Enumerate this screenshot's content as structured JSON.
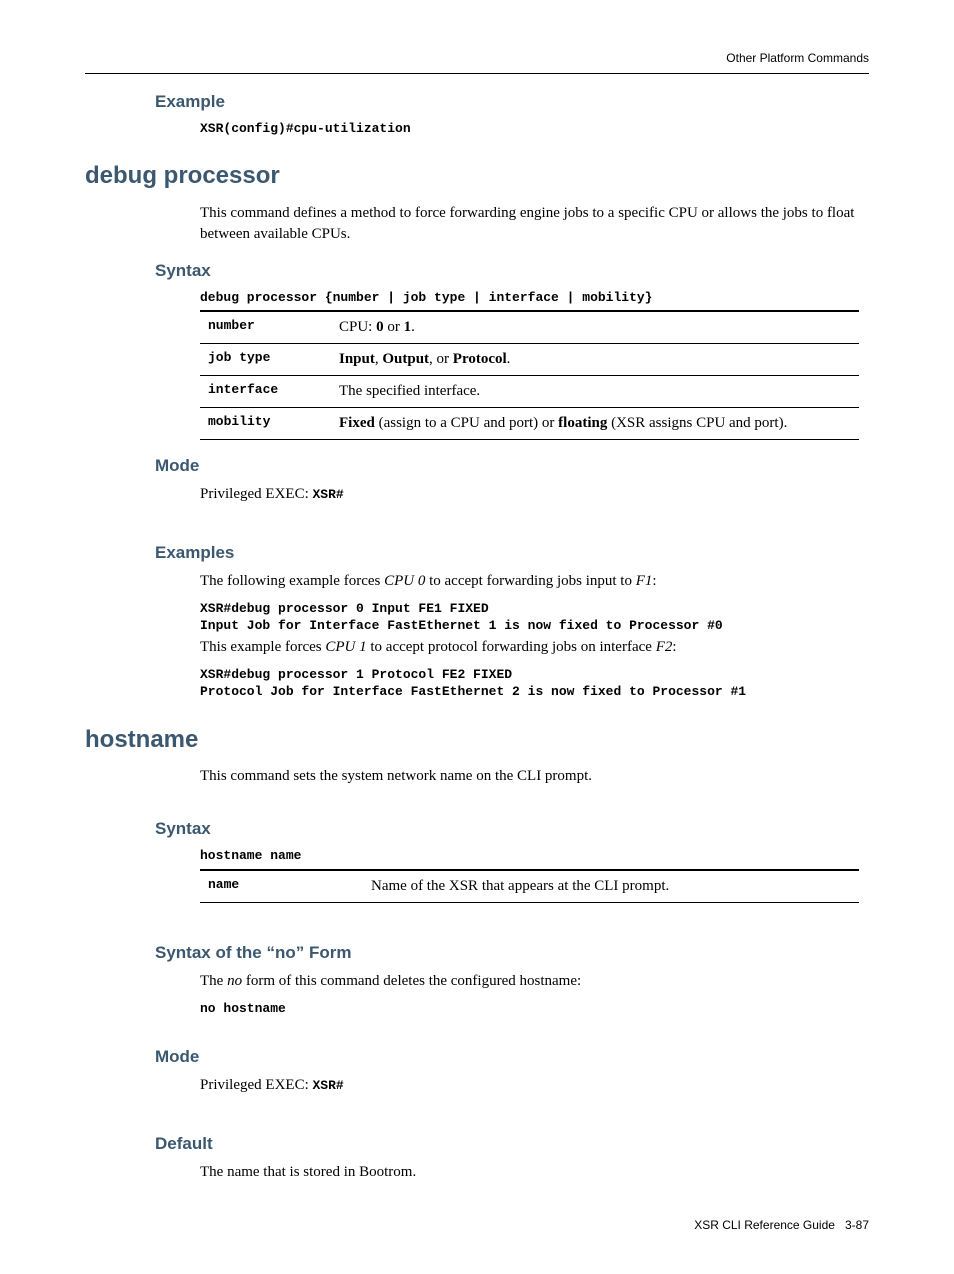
{
  "header": "Other Platform Commands",
  "s1": {
    "title": "Example",
    "code": "XSR(config)#cpu-utilization"
  },
  "s2": {
    "title": "debug processor",
    "intro": "This command defines a method to force forwarding engine jobs to a specific CPU or allows the jobs to float between available CPUs.",
    "syntax_title": "Syntax",
    "syntax_line": "debug processor {number | job type | interface | mobility}",
    "rows": [
      {
        "k": "number",
        "pre": "CPU: ",
        "b1": "0",
        "mid": " or ",
        "b2": "1",
        "post": "."
      },
      {
        "k": "job type",
        "b1": "Input",
        "sep1": ", ",
        "b2": "Output",
        "sep2": ", or ",
        "b3": "Protocol",
        "post": "."
      },
      {
        "k": "interface",
        "text": "The specified interface."
      },
      {
        "k": "mobility",
        "b1": "Fixed",
        "mid1": " (assign to a CPU and port) or ",
        "b2": "floating",
        "mid2": " (XSR assigns CPU and port)."
      }
    ],
    "mode_title": "Mode",
    "mode_pre": "Privileged EXEC: ",
    "mode_code": "XSR#",
    "examples_title": "Examples",
    "ex1_pre": "The following example forces ",
    "ex1_i1": "CPU 0",
    "ex1_mid": " to accept forwarding jobs input to ",
    "ex1_i2": "F1",
    "ex1_post": ":",
    "ex1_code": "XSR#debug processor 0 Input FE1 FIXED\nInput Job for Interface FastEthernet 1 is now fixed to Processor #0",
    "ex2_pre": "This example forces ",
    "ex2_i1": "CPU 1",
    "ex2_mid": " to accept protocol forwarding jobs on interface ",
    "ex2_i2": "F2",
    "ex2_post": ":",
    "ex2_code": "XSR#debug processor 1 Protocol FE2 FIXED\nProtocol Job for Interface FastEthernet 2 is now fixed to Processor #1"
  },
  "s3": {
    "title": "hostname",
    "intro": "This command sets the system network name on the CLI prompt.",
    "syntax_title": "Syntax",
    "syntax_line": "hostname name",
    "row_k": "name",
    "row_v": "Name of the XSR that appears at the CLI prompt.",
    "no_title": "Syntax of the “no” Form",
    "no_pre": "The ",
    "no_i": "no",
    "no_post": " form of this command deletes the configured hostname:",
    "no_code": "no hostname",
    "mode_title": "Mode",
    "mode_pre": "Privileged EXEC: ",
    "mode_code": "XSR#",
    "default_title": "Default",
    "default_text": "The name that is stored in Bootrom."
  },
  "footer": {
    "doc": "XSR CLI Reference Guide",
    "page": "3-87"
  }
}
